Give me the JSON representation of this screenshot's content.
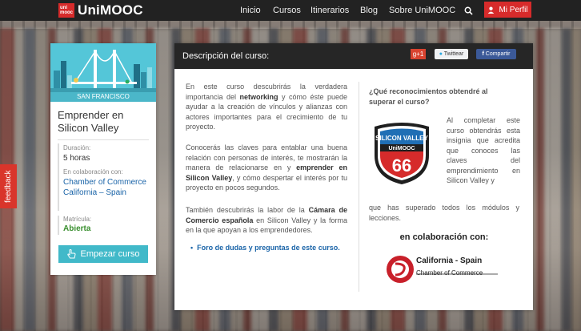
{
  "brand": {
    "logo_top": "uni",
    "logo_bottom": "mooc",
    "name": "UniMOOC"
  },
  "nav": {
    "links": [
      "Inicio",
      "Cursos",
      "Itinerarios",
      "Blog",
      "Sobre UniMOOC"
    ],
    "profile_label": "Mi Perfil",
    "search_icon": "search-icon",
    "user_icon": "user-icon"
  },
  "feedback_label": "feedback",
  "course_card": {
    "banner_label": "SAN FRANCISCO",
    "title": "Emprender en Silicon Valley",
    "duration_label": "Duración:",
    "duration_value": "5 horas",
    "collab_label": "En colaboración con:",
    "collab_value": "Chamber of Commerce California – Spain",
    "enrollment_label": "Matrícula:",
    "enrollment_value": "Abierta",
    "start_button": "Empezar curso"
  },
  "panel": {
    "title": "Descripción del curso:",
    "share": {
      "gplus": "g+1",
      "twitter": "Twittear",
      "facebook": "Compartir"
    },
    "paragraphs": [
      [
        "En este curso descubrirás la verdadera importancia del ",
        "networking",
        " y cómo éste puede ayudar a la creación de vínculos y alianzas con actores importantes para el crecimiento de tu proyecto."
      ],
      [
        "Conocerás las claves para entablar una buena relación con personas de interés, te mostrarán la manera de relacionarse en y ",
        "emprender en Silicon Valley",
        ", y cómo despertar el interés por tu proyecto en pocos segundos."
      ],
      [
        "También descubrirás la labor de la ",
        "Cámara de Comercio española",
        " en Silicon Valley y la forma en la que apoyan a los emprendedores."
      ]
    ],
    "forum_link": "Foro de dudas y preguntas de este curso.",
    "question": "¿Qué reconocimientos obtendré al superar el curso?",
    "badge": {
      "top": "SILICON VALLEY",
      "middle": "UniMOOC",
      "number": "66"
    },
    "badge_text_side": "Al completar este curso obtendrás esta insignia que acredita que conoces las claves del emprendimiento en Silicon Valley y",
    "badge_text_full": "que has superado todos los módulos y lecciones.",
    "collab_heading": "en colaboración con:",
    "partner": {
      "name": "California - Spain",
      "sub": "Chamber of Commerce"
    }
  },
  "colors": {
    "accent": "#d72b2b",
    "teal": "#41b9c9",
    "link": "#1a64a8",
    "dark": "#262626"
  }
}
